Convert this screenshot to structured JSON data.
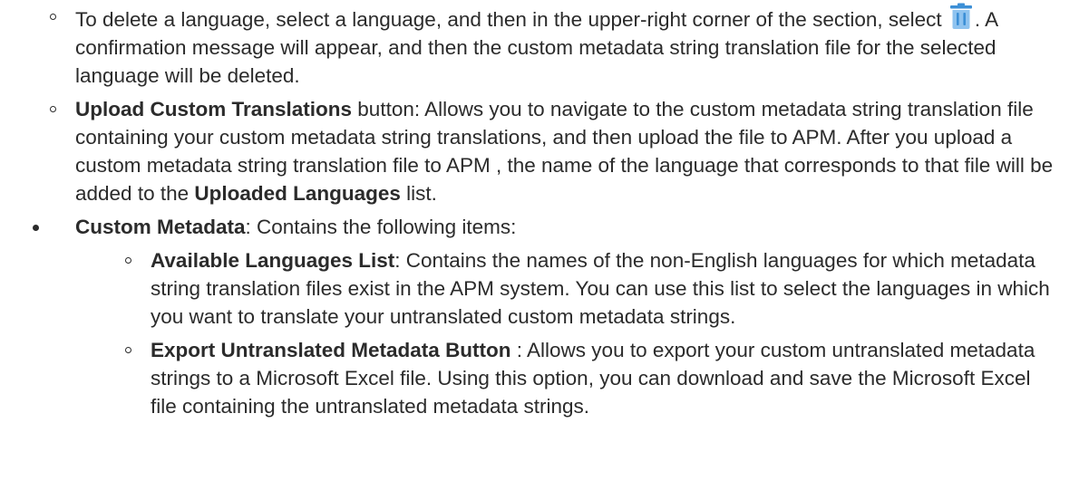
{
  "delete_item": {
    "before_icon": "To delete a language, select a language, and then in the upper-right corner of the section, select ",
    "icon": "trash-icon",
    "after_icon": ". A confirmation message will appear, and then the custom metadata string translation file for the selected language will be deleted."
  },
  "upload_item": {
    "label": "Upload Custom Translations",
    "text_1": " button: Allows you to navigate to the custom metadata string translation file containing your custom metadata string translations, and then upload the file to APM. After you upload a custom metadata string translation file to APM , the name of the language that corresponds to that file will be added to the ",
    "list_label": "Uploaded Languages",
    "text_2": " list."
  },
  "custom_metadata": {
    "label": "Custom Metadata",
    "text": ": Contains the following items:",
    "items": [
      {
        "label": "Available Languages List",
        "text": ": Contains the names of the non-English languages for which metadata string translation files exist in the APM system. You can use this list to select the languages in which you want to translate your untranslated custom metadata strings."
      },
      {
        "label": "Export Untranslated Metadata Button",
        "text": " : Allows you to export your custom untranslated metadata strings to a Microsoft Excel file. Using this option, you can download and save the Microsoft Excel file containing the untranslated metadata strings."
      }
    ]
  },
  "colors": {
    "text": "#2b2b2b",
    "icon": "#3c8fd6"
  }
}
